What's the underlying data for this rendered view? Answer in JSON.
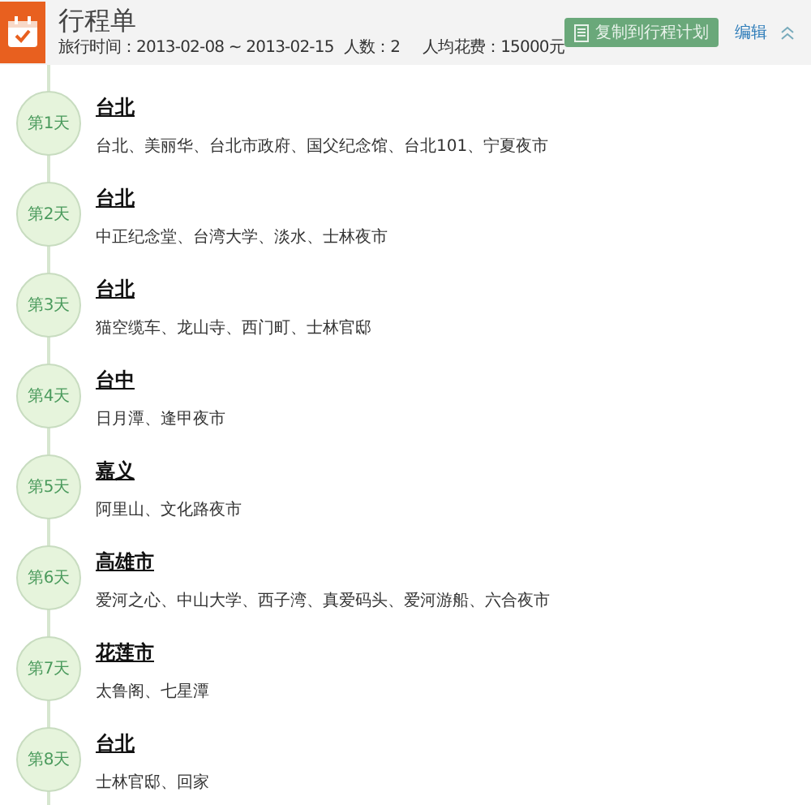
{
  "header": {
    "title": "行程单",
    "dates": "旅行时间：2013-02-08 ~ 2013-02-15",
    "people": "人数：2",
    "cost": "人均花费：15000元",
    "copy_button": "复制到行程计划",
    "edit_link": "编辑"
  },
  "days": [
    {
      "day": "第1天",
      "city": "台北",
      "places": "台北、美丽华、台北市政府、国父纪念馆、台北101、宁夏夜市"
    },
    {
      "day": "第2天",
      "city": "台北",
      "places": "中正纪念堂、台湾大学、淡水、士林夜市"
    },
    {
      "day": "第3天",
      "city": "台北",
      "places": "猫空缆车、龙山寺、西门町、士林官邸"
    },
    {
      "day": "第4天",
      "city": "台中",
      "places": "日月潭、逢甲夜市"
    },
    {
      "day": "第5天",
      "city": "嘉义",
      "places": "阿里山、文化路夜市"
    },
    {
      "day": "第6天",
      "city": "高雄市",
      "places": "爱河之心、中山大学、西子湾、真爱码头、爱河游船、六合夜市"
    },
    {
      "day": "第7天",
      "city": "花莲市",
      "places": "太鲁阁、七星潭"
    },
    {
      "day": "第8天",
      "city": "台北",
      "places": "士林官邸、回家"
    }
  ]
}
